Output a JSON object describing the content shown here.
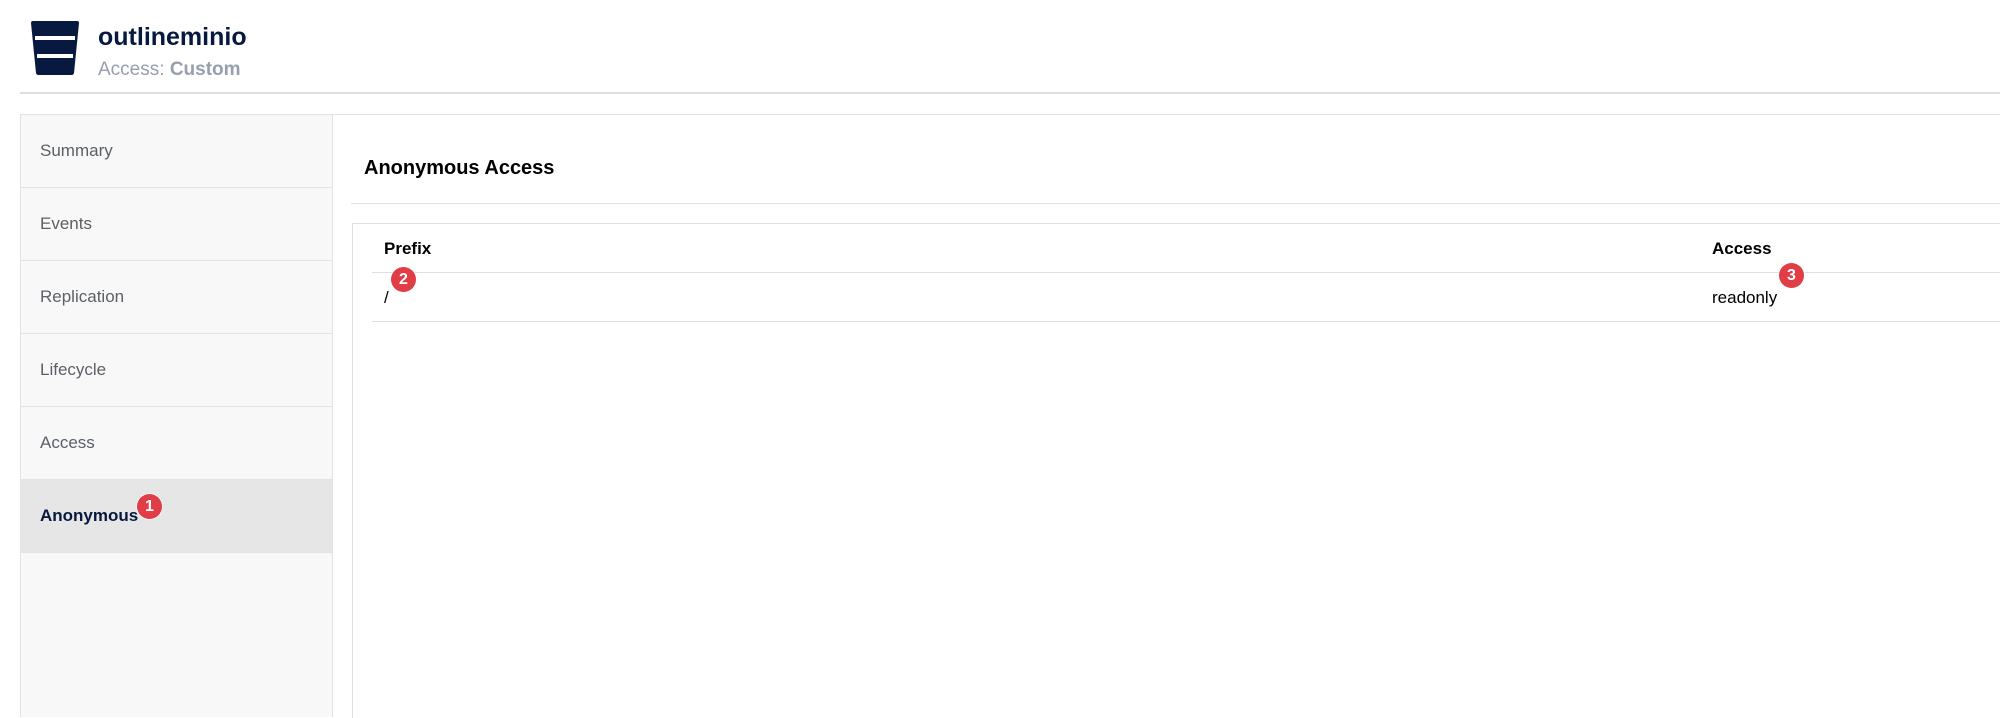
{
  "header": {
    "bucket_name": "outlineminio",
    "access_label": "Access:",
    "access_value": "Custom",
    "icon": "bucket-icon"
  },
  "sidebar": {
    "items": [
      {
        "label": "Summary",
        "active": false
      },
      {
        "label": "Events",
        "active": false
      },
      {
        "label": "Replication",
        "active": false
      },
      {
        "label": "Lifecycle",
        "active": false
      },
      {
        "label": "Access",
        "active": false
      },
      {
        "label": "Anonymous",
        "active": true
      }
    ]
  },
  "main": {
    "title": "Anonymous Access",
    "table": {
      "columns": [
        "Prefix",
        "Access"
      ],
      "rows": [
        {
          "prefix": "/",
          "access": "readonly"
        }
      ]
    }
  },
  "markers": [
    "1",
    "2",
    "3"
  ],
  "colors": {
    "brand_dark": "#07193e",
    "marker_red": "#e03d46",
    "sidebar_bg": "#f8f8f8",
    "active_bg": "#e6e6e6"
  }
}
